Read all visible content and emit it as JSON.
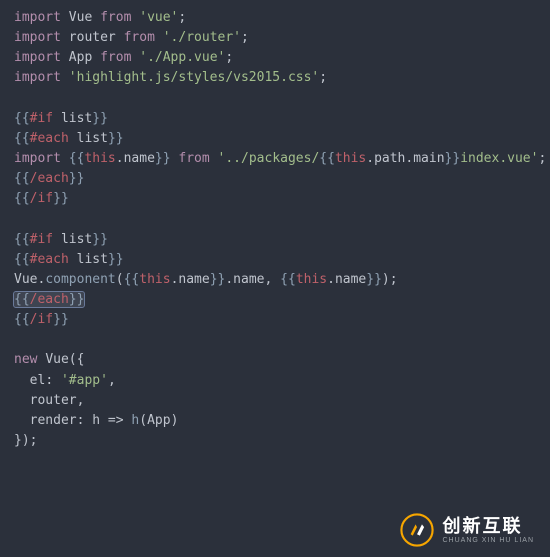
{
  "code": {
    "l1": {
      "kw_import": "import",
      "ident": "Vue",
      "kw_from": "from",
      "str": "'vue'",
      "semi": ";"
    },
    "l2": {
      "kw_import": "import",
      "ident": "router",
      "kw_from": "from",
      "str": "'./router'",
      "semi": ";"
    },
    "l3": {
      "kw_import": "import",
      "ident": "App",
      "kw_from": "from",
      "str": "'./App.vue'",
      "semi": ";"
    },
    "l4": {
      "kw_import": "import",
      "str": "'highlight.js/styles/vs2015.css'",
      "semi": ";"
    },
    "l6": {
      "o": "{{",
      "h": "#if",
      "sp": " ",
      "v": "list",
      "c": "}}"
    },
    "l7": {
      "o": "{{",
      "h": "#each",
      "sp": " ",
      "v": "list",
      "c": "}}"
    },
    "l8": {
      "kw_import": "import",
      "o1": "{{",
      "this1": "this",
      "name1": ".name",
      "c1": "}}",
      "kw_from": "from",
      "str1": "'../packages/",
      "o2": "{{",
      "this2": "this",
      "path": ".path.main",
      "c2": "}}",
      "str2": "index.vue'",
      "semi": ";"
    },
    "l9": {
      "o": "{{",
      "h": "/each",
      "c": "}}"
    },
    "l10": {
      "o": "{{",
      "h": "/if",
      "c": "}}"
    },
    "l12": {
      "o": "{{",
      "h": "#if",
      "sp": " ",
      "v": "list",
      "c": "}}"
    },
    "l13": {
      "o": "{{",
      "h": "#each",
      "sp": " ",
      "v": "list",
      "c": "}}"
    },
    "l14": {
      "vue": "Vue",
      "dot": ".",
      "comp": "component",
      "paren_o": "(",
      "o1": "{{",
      "this1": "this",
      "name1": ".name",
      "c1": "}}",
      "nameprop": ".name",
      "comma": ", ",
      "o2": "{{",
      "this2": "this",
      "name2": ".name",
      "c2": "}}",
      "paren_c": ")",
      "semi": ";"
    },
    "l15": {
      "o": "{{",
      "h": "/each",
      "c": "}}"
    },
    "l16": {
      "o": "{{",
      "h": "/if",
      "c": "}}"
    },
    "l18": {
      "kw_new": "new",
      "vue": "Vue",
      "paren": "({"
    },
    "l19": {
      "key": "el",
      "colon": ": ",
      "val": "'#app'",
      "comma": ","
    },
    "l20": {
      "key": "router",
      "comma": ","
    },
    "l21": {
      "key": "render",
      "colon": ": ",
      "h1": "h",
      "arrow": " => ",
      "h2": "h",
      "p_o": "(",
      "app": "App",
      "p_c": ")"
    },
    "l22": {
      "close": "});"
    }
  },
  "watermark": {
    "zh": "创新互联",
    "en": "CHUANG XIN HU LIAN"
  }
}
